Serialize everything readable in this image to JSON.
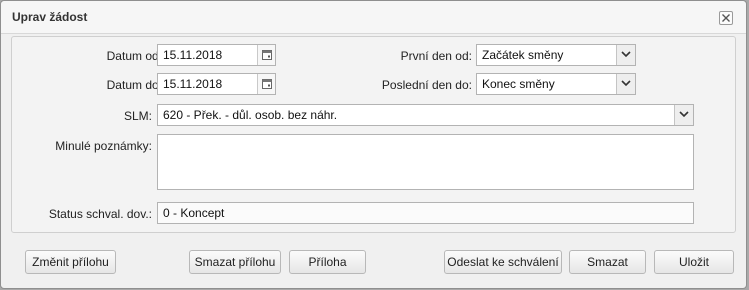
{
  "dialog": {
    "title": "Uprav žádost"
  },
  "form": {
    "date_from_label": "Datum od:",
    "date_from_value": "15.11.2018",
    "date_to_label": "Datum do:",
    "date_to_value": "15.11.2018",
    "first_day_label": "První den od:",
    "first_day_value": "Začátek směny",
    "last_day_label": "Poslední den do:",
    "last_day_value": "Konec směny",
    "slm_label": "SLM:",
    "slm_value": "620 - Přek. - důl. osob. bez náhr.",
    "notes_label": "Minulé poznámky:",
    "notes_value": "",
    "status_label": "Status schval. dov.:",
    "status_value": "0 - Koncept"
  },
  "buttons": {
    "change_attachment": "Změnit přílohu",
    "delete_attachment": "Smazat přílohu",
    "attachment": "Příloha",
    "send_for_approval": "Odeslat ke schválení",
    "delete": "Smazat",
    "save": "Uložit"
  },
  "icons": {
    "close": "close-icon",
    "calendar": "calendar-icon",
    "dropdown": "chevron-down-icon"
  }
}
